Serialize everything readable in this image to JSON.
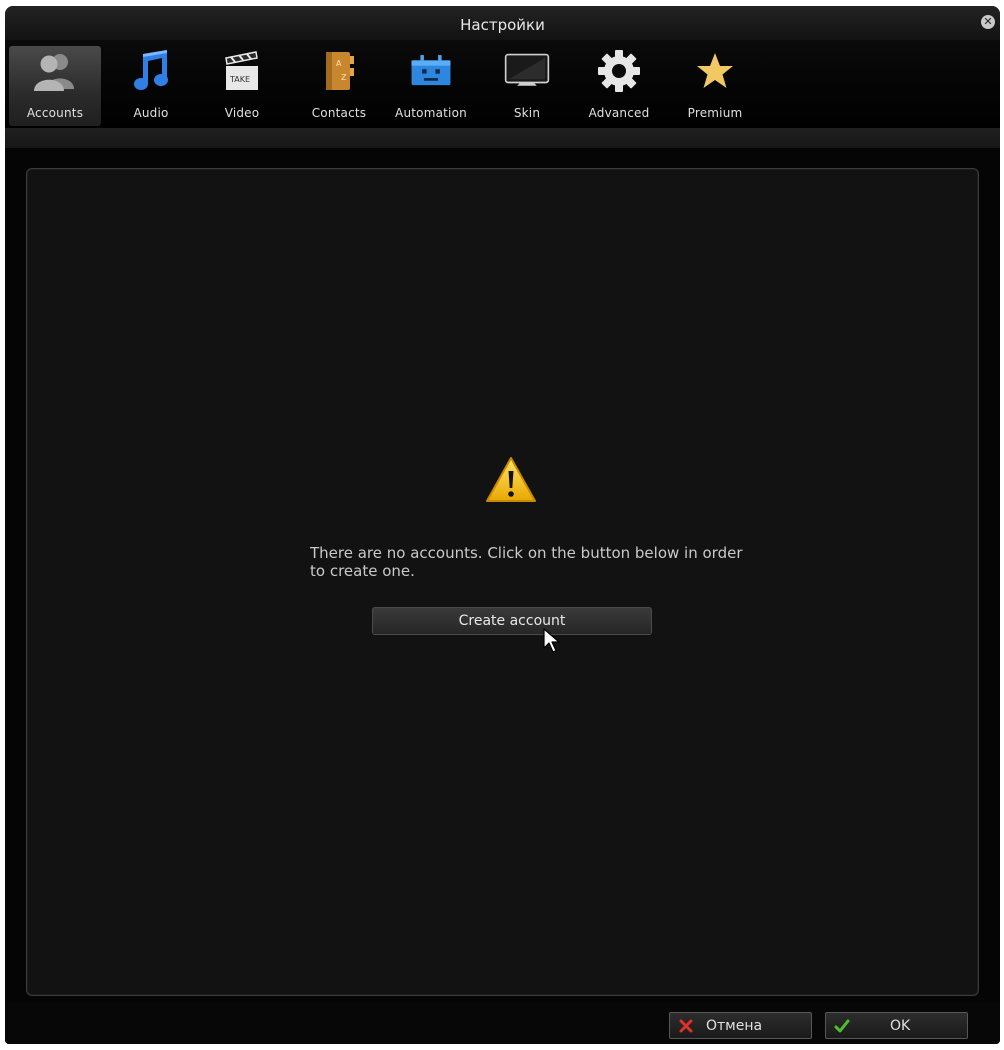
{
  "window": {
    "title": "Настройки"
  },
  "toolbar": {
    "tabs": [
      {
        "label": "Accounts",
        "icon": "accounts-icon",
        "active": true
      },
      {
        "label": "Audio",
        "icon": "music-note-icon",
        "active": false
      },
      {
        "label": "Video",
        "icon": "clapperboard-icon",
        "active": false
      },
      {
        "label": "Contacts",
        "icon": "address-book-icon",
        "active": false
      },
      {
        "label": "Automation",
        "icon": "robot-icon",
        "active": false
      },
      {
        "label": "Skin",
        "icon": "monitor-icon",
        "active": false
      },
      {
        "label": "Advanced",
        "icon": "gear-icon",
        "active": false
      },
      {
        "label": "Premium",
        "icon": "star-icon",
        "active": false
      }
    ]
  },
  "main": {
    "message": "There are no accounts. Click on the button below in order to create one.",
    "create_button": "Create account"
  },
  "footer": {
    "cancel_label": "Отмена",
    "ok_label": "OK"
  },
  "colors": {
    "background": "#050505",
    "panel": "#121212",
    "warning": "#f5c400",
    "cancel_icon": "#e0302a",
    "ok_icon": "#4ec02e"
  }
}
